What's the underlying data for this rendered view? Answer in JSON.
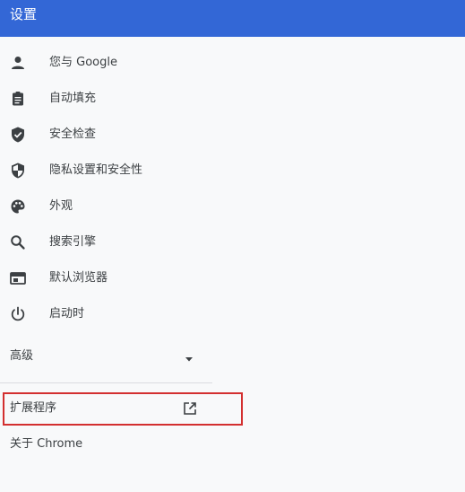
{
  "header": {
    "title": "设置"
  },
  "nav": {
    "items": [
      {
        "label": "您与 Google",
        "icon": "person-icon"
      },
      {
        "label": "自动填充",
        "icon": "clipboard-icon"
      },
      {
        "label": "安全检查",
        "icon": "shield-check-icon"
      },
      {
        "label": "隐私设置和安全性",
        "icon": "shield-half-icon"
      },
      {
        "label": "外观",
        "icon": "palette-icon"
      },
      {
        "label": "搜索引擎",
        "icon": "search-icon"
      },
      {
        "label": "默认浏览器",
        "icon": "browser-window-icon"
      },
      {
        "label": "启动时",
        "icon": "power-icon"
      }
    ],
    "advanced_label": "高级",
    "extensions_label": "扩展程序",
    "about_label": "关于 Chrome"
  },
  "colors": {
    "header": "#3367d6",
    "highlight_box": "#d32f2f",
    "icon": "#3c4043"
  }
}
